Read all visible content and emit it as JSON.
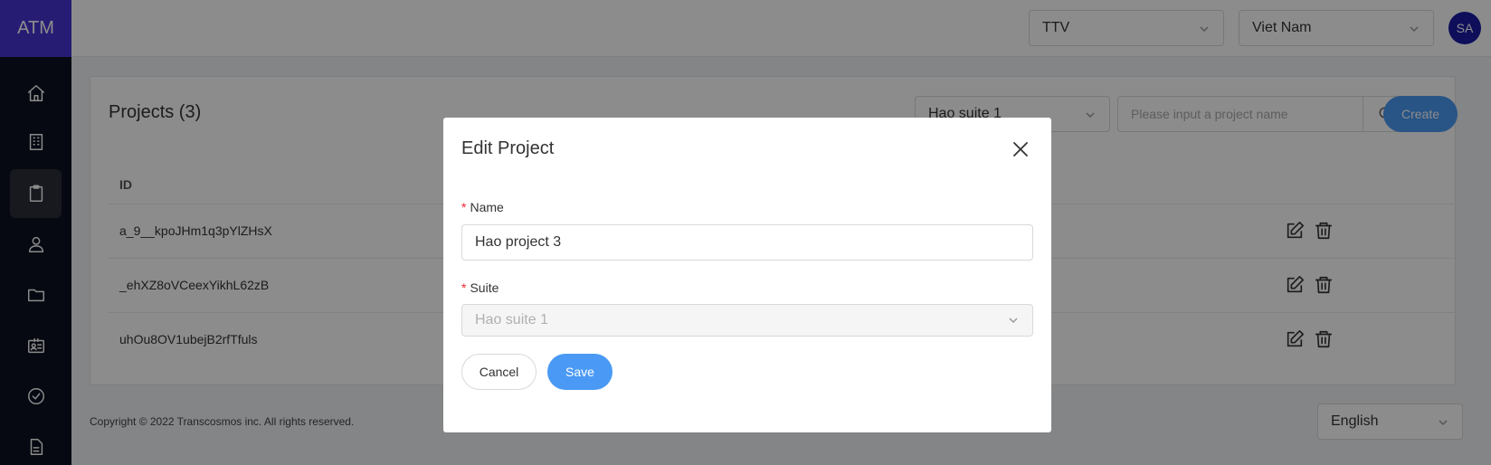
{
  "app": {
    "logo": "ATM"
  },
  "sidebar": {
    "items": [
      {
        "icon": "home-icon",
        "active": false
      },
      {
        "icon": "building-icon",
        "active": false
      },
      {
        "icon": "clipboard-icon",
        "active": true
      },
      {
        "icon": "user-icon",
        "active": false
      },
      {
        "icon": "folder-icon",
        "active": false
      },
      {
        "icon": "id-card-icon",
        "active": false
      },
      {
        "icon": "check-circle-icon",
        "active": false
      },
      {
        "icon": "document-icon",
        "active": false
      }
    ]
  },
  "header": {
    "company_select": "TTV",
    "country_select": "Viet Nam",
    "avatar_initials": "SA"
  },
  "projects": {
    "title": "Projects (3)",
    "suite_filter": "Hao suite 1",
    "search_placeholder": "Please input a project name",
    "create_label": "Create",
    "columns": [
      "ID"
    ],
    "rows": [
      {
        "id": "a_9__kpoJHm1q3pYlZHsX"
      },
      {
        "id": "_ehXZ8oVCeexYikhL62zB"
      },
      {
        "id": "uhOu8OV1ubejB2rfTfuls"
      }
    ]
  },
  "footer": {
    "copyright": "Copyright © 2022 Transcosmos inc. All rights reserved.",
    "language": "English"
  },
  "modal": {
    "title": "Edit Project",
    "name_label": "Name",
    "name_value": "Hao project 3",
    "suite_label": "Suite",
    "suite_value": "Hao suite 1",
    "cancel_label": "Cancel",
    "save_label": "Save"
  },
  "colors": {
    "accent": "#4a9af5",
    "logo_bg": "#4834d4",
    "sidebar_bg": "#0b1120",
    "required": "#f5222d"
  }
}
